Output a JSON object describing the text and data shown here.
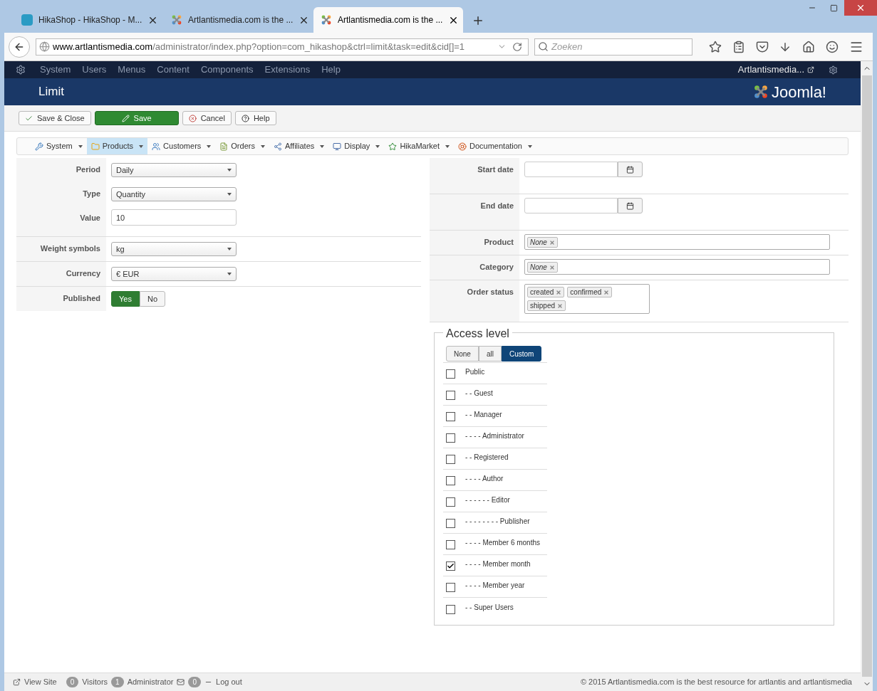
{
  "browser": {
    "tabs": [
      {
        "title": "HikaShop - HikaShop - M...",
        "selected": false,
        "kind": "hikashop"
      },
      {
        "title": "Artlantismedia.com is the ...",
        "selected": false,
        "kind": "joomla"
      },
      {
        "title": "Artlantismedia.com is the ...",
        "selected": true,
        "kind": "joomla"
      }
    ],
    "url_host": "www.artlantismedia.com",
    "url_path": "/administrator/index.php?option=com_hikashop&ctrl=limit&task=edit&cid[]=1",
    "search": {
      "placeholder": "Zoeken"
    }
  },
  "admin_menu": {
    "items": [
      "System",
      "Users",
      "Menus",
      "Content",
      "Components",
      "Extensions",
      "Help"
    ],
    "site_link": "Artlantismedia..."
  },
  "page_title": "Limit",
  "logo_text": "Joomla!",
  "toolbar": [
    {
      "label": "Save & Close",
      "kind": "save-close"
    },
    {
      "label": "Save",
      "kind": "save"
    },
    {
      "label": "Cancel",
      "kind": "cancel"
    },
    {
      "label": "Help",
      "kind": "help"
    }
  ],
  "submenu": [
    {
      "label": "System",
      "selected": false
    },
    {
      "label": "Products",
      "selected": true
    },
    {
      "label": "Customers",
      "selected": false
    },
    {
      "label": "Orders",
      "selected": false
    },
    {
      "label": "Affiliates",
      "selected": false
    },
    {
      "label": "Display",
      "selected": false
    },
    {
      "label": "HikaMarket",
      "selected": false
    },
    {
      "label": "Documentation",
      "selected": false
    }
  ],
  "left_form": [
    {
      "group": [
        {
          "label": "Period",
          "kind": "select",
          "value": "Daily"
        },
        {
          "label": "Type",
          "kind": "select",
          "value": "Quantity"
        },
        {
          "label": "Value",
          "kind": "input",
          "value": "10"
        }
      ]
    },
    {
      "group": [
        {
          "label": "Weight symbols",
          "kind": "select",
          "value": "kg"
        }
      ]
    },
    {
      "group": [
        {
          "label": "Currency",
          "kind": "select",
          "value": "€ EUR"
        }
      ]
    },
    {
      "group": [
        {
          "label": "Published",
          "kind": "toggle",
          "options": [
            {
              "label": "Yes",
              "selected": true
            },
            {
              "label": "No",
              "selected": false
            }
          ]
        }
      ]
    }
  ],
  "right_form": [
    {
      "label": "Start date",
      "kind": "date"
    },
    {
      "label": "End date",
      "kind": "date"
    },
    {
      "label": "Product",
      "kind": "tags",
      "tags": [
        "None"
      ],
      "italic": true
    },
    {
      "label": "Category",
      "kind": "tags",
      "tags": [
        "None"
      ],
      "italic": true
    },
    {
      "label": "Order status",
      "kind": "tagbox",
      "tags": [
        "created",
        "confirmed",
        "shipped"
      ],
      "italic": false
    }
  ],
  "access_level": {
    "title": "Access level",
    "modes": [
      {
        "label": "None",
        "selected": false
      },
      {
        "label": "all",
        "selected": false
      },
      {
        "label": "Custom",
        "selected": true
      }
    ],
    "groups": [
      {
        "label": "Public",
        "checked": false
      },
      {
        "label": "- - Guest",
        "checked": false
      },
      {
        "label": "- - Manager",
        "checked": false
      },
      {
        "label": "- - - - Administrator",
        "checked": false
      },
      {
        "label": "- - Registered",
        "checked": false
      },
      {
        "label": "- - - - Author",
        "checked": false
      },
      {
        "label": "- - - - - - Editor",
        "checked": false
      },
      {
        "label": "- - - - - - - - Publisher",
        "checked": false
      },
      {
        "label": "- - - - Member 6 months",
        "checked": false
      },
      {
        "label": "- - - - Member month",
        "checked": true
      },
      {
        "label": "- - - - Member year",
        "checked": false
      },
      {
        "label": "- - Super Users",
        "checked": false
      }
    ]
  },
  "status_bar": {
    "view_site": "View Site",
    "visitors_count": "0",
    "visitors": "Visitors",
    "admin_count": "1",
    "admin": "Administrator",
    "messages_count": "0",
    "logout": "Log out",
    "copyright": "© 2015 Artlantismedia.com is the best resource for artlantis and artlantismedia"
  }
}
